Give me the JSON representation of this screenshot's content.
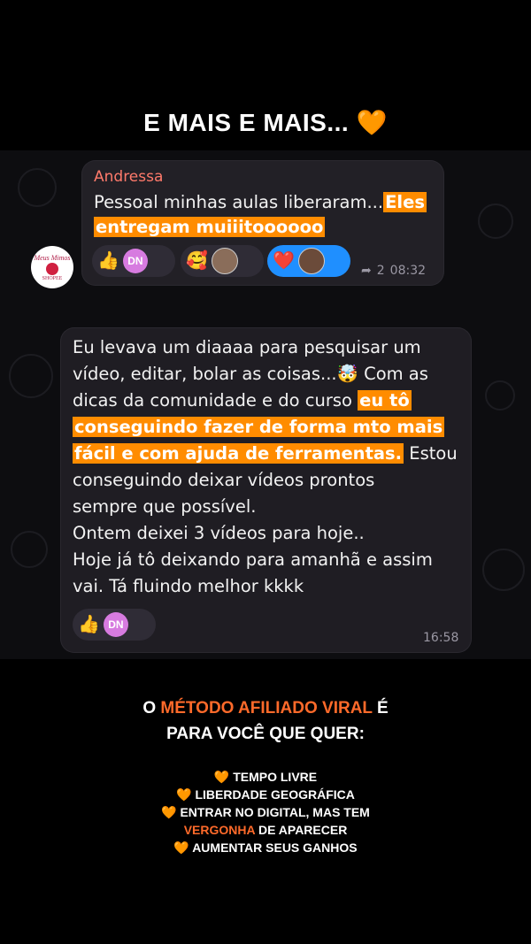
{
  "headline": {
    "text": "E  MAIS E MAIS...",
    "emoji": "🧡"
  },
  "chat1": {
    "sender": "Andressa",
    "text_plain": "Pessoal minhas aulas liberaram...",
    "text_highlight_a": "Eles",
    "text_highlight_b": "entregam muiiitoooooo",
    "avatar_label": "Meus Mimos",
    "avatar_sub": "SHOPEE",
    "reactions": [
      {
        "emoji": "👍",
        "user": "DN"
      },
      {
        "emoji": "🥰"
      },
      {
        "emoji": "❤️"
      }
    ],
    "reply_count": "2",
    "time": "08:32"
  },
  "chat2": {
    "lines": [
      "Eu levava um diaaaa para pesquisar um",
      "vídeo, editar, bolar as coisas...🤯 Com as",
      "dicas da comunidade e do curso "
    ],
    "highlight_1": "eu tô",
    "highlight_2": "conseguindo fazer de forma mto mais",
    "highlight_3": "fácil e com ajuda de ferramentas.",
    "after_highlight": " Estou",
    "rest_lines": [
      "conseguindo deixar vídeos prontos",
      "sempre que possível.",
      "Ontem deixei 3 vídeos para hoje..",
      "Hoje já tô deixando para amanhã e assim",
      "vai. Tá fluindo melhor kkkk"
    ],
    "reaction_emoji": "👍",
    "reaction_user": "DN",
    "time": "16:58"
  },
  "promo": {
    "prefix": "O ",
    "highlight": "MÉTODO AFILIADO VIRAL",
    "suffix": " É",
    "line2": "PARA VOCÊ QUE QUER:"
  },
  "benefits": {
    "heart": "🧡",
    "item1": "TEMPO LIVRE",
    "item2": "LIBERDADE GEOGRÁFICA",
    "item3": "ENTRAR NO DIGITAL, MAS TEM",
    "item3b_highlight": "VERGONHA",
    "item3b_rest": " DE APARECER",
    "item4": "AUMENTAR SEUS GANHOS"
  },
  "colors": {
    "accent_orange": "#ff6a2a",
    "highlight_bg": "#ff8c00",
    "sender": "#ff7a6b",
    "reaction_active": "#1f8fff"
  }
}
